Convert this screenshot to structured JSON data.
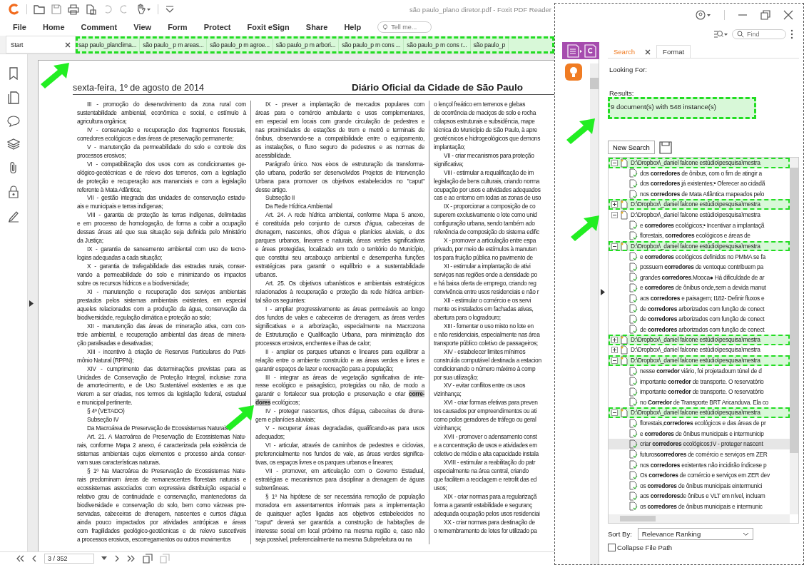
{
  "title_bar": {
    "title": "são paulo_plano diretor.pdf - Foxit PDF Reader"
  },
  "menu": [
    "File",
    "Home",
    "Comment",
    "View",
    "Form",
    "Protect",
    "Foxit eSign",
    "Share",
    "Help"
  ],
  "tell_me": {
    "placeholder": "Tell me..."
  },
  "tab_bar": {
    "highlighted": true,
    "tabs": [
      {
        "label": "Start",
        "selected": true
      },
      {
        "label": "sap paulo_planclima...",
        "selected": false
      },
      {
        "label": "são paulo_ p m areas...",
        "selected": false
      },
      {
        "label": "são paulo_p m agroe...",
        "selected": false
      },
      {
        "label": "são paulo_p m arbori...",
        "selected": false
      },
      {
        "label": "são paulo_p m cons ...",
        "selected": false
      },
      {
        "label": "são paulo_p m cons r...",
        "selected": false
      },
      {
        "label": "são paulo_p",
        "selected": false
      }
    ]
  },
  "document": {
    "header_date": "sexta-feira, 1º de agosto de 2014",
    "header_title": "Diário Oficial da Cidade de São Paulo",
    "columns": [
      {
        "paragraphs": [
          {
            "lines": [
              "III - promoção do desenvolvimento da zona rural com",
              "sustentabilidade ambiental, econômica e social, e estímulo à",
              "agricultura orgânica;"
            ]
          },
          {
            "lines": [
              "IV - conservação e recuperação dos fragmentos florestais,",
              "corredores ecológicos e das áreas de preservação permanente;"
            ]
          },
          {
            "lines": [
              "V - manutenção da permeabilidade do solo e controle dos",
              "processos erosivos;"
            ]
          },
          {
            "lines": [
              "VI - compatibilização dos usos com as condicionantes ge-",
              "ológico-geotécnicas e de relevo dos terrenos, com a legislação",
              "de proteção e recuperação aos mananciais e com a legislação",
              "referente à Mata Atlântica;"
            ]
          },
          {
            "lines": [
              "VII - gestão integrada das unidades de conservação estadu-",
              "ais e municipais e terras indígenas;"
            ]
          },
          {
            "lines": [
              "VIII - garantia de proteção às terras indígenas, delimitadas",
              "e em processo de homologação, de forma a coibir a ocupação",
              "dessas áreas até que sua situação seja definida pelo Ministério",
              "da Justiça;"
            ]
          },
          {
            "lines": [
              "IX - garantia de saneamento ambiental com uso de tecno-",
              "logias adequadas a cada situação;"
            ]
          },
          {
            "lines": [
              "X - garantia de trafegabilidade das estradas rurais, conser-",
              "vando a permeabilidade do solo e minimizando os impactos",
              "sobre os recursos hídricos e a biodiversidade;"
            ]
          },
          {
            "lines": [
              "XI - manutenção e recuperação dos serviços ambientais",
              "prestados pelos sistemas ambientais existentes, em especial",
              "aqueles relacionados com a produção da água, conservação da",
              "biodiversidade, regulação climática e proteção ao solo;"
            ]
          },
          {
            "lines": [
              "XII - manutenção das áreas de mineração ativa, com con-",
              "trole ambiental, e recuperação ambiental das áreas de minera-",
              "ção paralisadas e desativadas;"
            ]
          },
          {
            "lines": [
              "XIII - incentivo à criação de Reservas Particulares do Patri-",
              "mônio Natural (RPPN);"
            ]
          },
          {
            "lines": [
              "XIV - cumprimento das determinações previstas para as",
              "Unidades de Conservação de Proteção Integral, inclusive zona",
              "de amortecimento, e de Uso Sustentável existentes e as que",
              "vierem a ser criadas, nos termos da legislação federal, estadual",
              "e municipal pertinente."
            ]
          },
          {
            "lines": [
              "§ 4º (VETADO)"
            ]
          },
          {
            "lines": [
              "Subseção IV"
            ]
          },
          {
            "lines": [
              "Da Macroárea de Preservação de Ecossistemas Naturais"
            ]
          },
          {
            "lines": [
              "Art. 21. A Macroárea de Preservação de Ecossistemas Natu-",
              "rais, conforme Mapa 2 anexo, é caracterizada pela existência de",
              "sistemas ambientais cujos elementos e processo ainda conser-",
              "vam suas características naturais."
            ]
          },
          {
            "lines": [
              "§ 1º Na Macroárea de Preservação de Ecossistemas Natu-",
              "rais predominam áreas de remanescentes florestais naturais e",
              "ecossistemas associados com expressiva distribuição espacial e",
              "relativo grau de continuidade e conservação, mantenedoras da",
              "biodiversidade e conservação do solo, bem como várzeas pre-",
              "servadas, cabeceiras de drenagem, nascentes e cursos d'água",
              "ainda pouco impactados por atividades antrópicas e áreas",
              "com fragilidades geológico-geotécnicas e de relevo suscetíveis",
              "a processos erosivos, escorregamentos ou outros movimentos"
            ]
          }
        ]
      },
      {
        "paragraphs": [
          {
            "lines": [
              "IX - prever a implantação de mercados populares com",
              "áreas para o comércio ambulante e usos complementares,",
              "em especial em locais com grande circulação de pedestres e",
              "nas proximidades de estações de trem e metrô e terminais de",
              "ônibus, observando-se a compatibilidade entre o equipamento,",
              "as instalações, o fluxo seguro de pedestres e as normas de",
              "acessibilidade."
            ]
          },
          {
            "lines": [
              "Parágrafo único. Nos eixos de estruturação da transforma-",
              "ção urbana, poderão ser desenvolvidos Projetos de Intervenção",
              "Urbana para promover os objetivos estabelecidos no \"caput\"",
              "desse artigo."
            ]
          },
          {
            "lines": [
              "Subseção II"
            ]
          },
          {
            "lines": [
              "Da Rede Hídrica Ambiental"
            ]
          },
          {
            "lines": [
              "Art. 24. A rede hídrica ambiental, conforme Mapa 5 anexo,",
              "é constituída pelo conjunto de cursos d'água, cabeceiras de",
              "drenagem, nascentes, olhos d'água e planícies aluviais, e dos",
              "parques urbanos, lineares e naturais, áreas verdes significativas",
              "e áreas protegidas, localizado em todo o território do Município,",
              "que constitui seu arcabouço ambiental e desempenha funções",
              "estratégicas para garantir o equilíbrio e a sustentabilidade",
              "urbanos."
            ]
          },
          {
            "lines": [
              "Art. 25. Os objetivos urbanísticos e ambientais estratégicos",
              "relacionados à recuperação e proteção da rede hídrica ambien-",
              "tal são os seguintes:"
            ]
          },
          {
            "lines": [
              "I - ampliar progressivamente as áreas permeáveis ao longo",
              "dos fundos de vales e cabeceiras de drenagem, as áreas verdes",
              "significativas e a arborização, especialmente na Macrozona",
              "de Estruturação e Qualificação Urbana, para minimização dos",
              "processos erosivos, enchentes e ilhas de calor;"
            ]
          },
          {
            "lines": [
              "II - ampliar os parques urbanos e lineares para equilibrar a",
              "relação entre o ambiente construído e as áreas verdes e livres e",
              "garantir espaços de lazer e recreação para a população;"
            ]
          },
          {
            "lines": [
              "III - integrar as áreas de vegetação significativa de inte-",
              "resse ecológico e paisagístico, protegidas ou não, de modo a",
              "garantir e fortalecer sua proteção e preservação e criar **corre-**",
              "**dores** ecológicos;"
            ]
          },
          {
            "lines": [
              "IV - proteger nascentes, olhos d'água, cabeceiras de drena-",
              "gem e planícies aluviais;"
            ]
          },
          {
            "lines": [
              "V - recuperar áreas degradadas, qualificando-as para usos",
              "adequados;"
            ]
          },
          {
            "lines": [
              "VI - articular, através de caminhos de pedestres e ciclovias,",
              "preferencialmente nos fundos de vale, as áreas verdes significa-",
              "tivas, os espaços livres e os parques urbanos e lineares;"
            ]
          },
          {
            "lines": [
              "VII - promover, em articulação com o Governo Estadual,",
              "estratégias e mecanismos para disciplinar a drenagem de águas",
              "subterrâneas."
            ]
          },
          {
            "lines": [
              "§ 1º Na hipótese de ser necessária remoção de população",
              "moradora em assentamentos informais para a implementação",
              "de quaisquer ações ligadas aos objetivos estabelecidos no",
              "\"caput\" deverá ser garantida a construção de habitações de",
              "interesse social em local próximo na mesma região e, caso não",
              "seja possível, preferencialmente na mesma Subprefeitura ou na"
            ]
          }
        ]
      },
      {
        "cut": true,
        "paragraphs": [
          {
            "continued": true,
            "lines": [
              "o lençol freático em terrenos e glebas",
              "de ocorrência de maciços de solo e rocha",
              "colapsos estruturais e subsidência, mape",
              "técnica do Município de São Paulo, à apre",
              "geotécnicos e hidrogeológicos que demons",
              "implantação;"
            ]
          },
          {
            "lines": [
              "VII - criar mecanismos para proteção",
              "significativa;"
            ]
          },
          {
            "lines": [
              "VIII - estimular a requalificação de im",
              "legislação de bens culturais, criando norma",
              "ocupação por usos e atividades adequados",
              "cas e ao entorno em todas as zonas de uso"
            ]
          },
          {
            "lines": [
              "IX - proporcionar a composição de co",
              "superem exclusivamente o lote como unid",
              "configuração urbana, sendo também ado",
              "referência de composição do sistema edific"
            ]
          },
          {
            "lines": [
              "X - promover a articulação entre espa",
              "privado, por meio de estímulos à manuten",
              "tos para fruição pública no pavimento de"
            ]
          },
          {
            "lines": [
              "XI - estimular a implantação de ativi",
              "serviços nas regiões onde a densidade po",
              "e há baixa oferta de emprego, criando reg",
              "convivência entre usos residenciais e não r"
            ]
          },
          {
            "lines": [
              "XII - estimular o comércio e os servi",
              "mente os instalados em fachadas ativas,",
              "abertura para o logradouro;"
            ]
          },
          {
            "lines": [
              "XIII - fomentar o uso misto no lote en",
              "e não residenciais, especialmente nas área",
              "transporte público coletivo de passageiros;"
            ]
          },
          {
            "lines": [
              "XIV - estabelecer limites mínimos",
              "construída computável destinada a estacion",
              "condicionando o número máximo à comp",
              "por sua utilização;"
            ]
          },
          {
            "lines": [
              "XV - evitar conflitos entre os usos",
              "vizinhança;"
            ]
          },
          {
            "lines": [
              "XVI - criar formas efetivas para preven",
              "tos causados por empreendimentos ou ati",
              "como polos geradores de tráfego ou geral",
              "vizinhança;"
            ]
          },
          {
            "lines": [
              "XVII - promover o adensamento const",
              "e a concentração de usos e atividades em",
              "coletivo de média e alta capacidade instala"
            ]
          },
          {
            "lines": [
              "XVIII - estimular a reabilitação do patr",
              "especialmente na área central, criando",
              "que facilitem a reciclagem e retrofit das ed",
              "usos;"
            ]
          },
          {
            "lines": [
              "XIX - criar normas para a regularizaçã",
              "forma a garantir estabilidade e seguranç",
              "adequada ocupação pelos usos residenciai"
            ]
          },
          {
            "lines": [
              "XX - criar normas para destinação de",
              "o remembramento de lotes for utilizado pa"
            ]
          }
        ]
      }
    ]
  },
  "page_nav": {
    "page": "3 / 352"
  },
  "find": {
    "placeholder": "Find"
  },
  "search_panel": {
    "tabs": [
      {
        "label": "Search",
        "selected": true
      },
      {
        "label": "Format",
        "selected": false
      }
    ],
    "looking_for_label": "Looking For:",
    "results_label": "Results:",
    "summary": {
      "text": "9 document(s) with 548 instance(s)",
      "highlighted": true
    },
    "new_search": "New Search",
    "results": [
      {
        "path": "D:\\Dropbox\\_daniel falcone estúdio\\pesquisa\\mestra",
        "expanded": true,
        "highlighted": true,
        "children": [
          {
            "text": "dos **corredores** de ônibus, com o fim de atingir a",
            "selected": false
          },
          {
            "text": "dos **corredores** já existentes;• Oferecer ao cidadã",
            "selected": false
          },
          {
            "text": "nos **corredores** de Mata Atlântica mapeados pelo",
            "selected": false
          }
        ]
      },
      {
        "path": "D:\\Dropbox\\_daniel falcone estúdio\\pesquisa\\mestra",
        "expanded": false,
        "highlighted": true
      },
      {
        "path": "D:\\Dropbox\\_daniel falcone estúdio\\pesquisa\\mestra",
        "expanded": true,
        "highlighted": false,
        "children": [
          {
            "text": "e **corredores** ecológicos;• Incentivar a implantaçã",
            "selected": false
          },
          {
            "text": "florestais, **corredores** ecológicos e áreas de",
            "selected": false
          }
        ]
      },
      {
        "path": "D:\\Dropbox\\_daniel falcone estúdio\\pesquisa\\mestra",
        "expanded": true,
        "highlighted": true,
        "children": [
          {
            "text": "e **corredores** ecológicos definidos no PMMA se fa",
            "selected": false
          },
          {
            "text": "possuem **corredores** de ventoque contribuem pa",
            "selected": false
          },
          {
            "text": "grandes **corredores**.Mooca● Há dificuldade de ar",
            "selected": false
          },
          {
            "text": "e **corredores** de ônibus onde,sem a devida manut",
            "selected": false
          },
          {
            "text": "aos **corredores** e paisagem; I182- Definir fluxos e",
            "selected": false
          },
          {
            "text": "de **corredores** arborizados com função de conect",
            "selected": false
          },
          {
            "text": "de **corredores** arborizados com função de conect",
            "selected": false
          },
          {
            "text": "de **corredores** arborizados com função de conect",
            "selected": false
          }
        ]
      },
      {
        "path": "D:\\Dropbox\\_daniel falcone estúdio\\pesquisa\\mestra",
        "expanded": false,
        "highlighted": true
      },
      {
        "path": "D:\\Dropbox\\_daniel falcone estúdio\\pesquisa\\mestra",
        "expanded": false,
        "highlighted": false
      },
      {
        "path": "D:\\Dropbox\\_daniel falcone estúdio\\pesquisa\\mestra",
        "expanded": true,
        "highlighted": true,
        "children": [
          {
            "text": "nesse **corredor** viário, foi projetadoum túnel de d",
            "selected": false
          },
          {
            "text": "importante **corredor** de transporte. O reservatório",
            "selected": false
          },
          {
            "text": "importante **corredor** de transporte. O reservatório",
            "selected": false
          },
          {
            "text": "no **Corredor** de Transporte BRT Aricanduva. Ela co",
            "selected": false
          }
        ]
      },
      {
        "path": "D:\\Dropbox\\_daniel falcone estúdio\\pesquisa\\mestra",
        "expanded": true,
        "highlighted": true,
        "children": [
          {
            "text": "florestais,**corredores** ecológicos e das áreas de pr",
            "selected": false
          },
          {
            "text": "e **corredores** de ônibus municipais e intermunicip",
            "selected": false
          },
          {
            "text": "criar **corredores** ecológicos;IV - proteger nascent",
            "selected": true
          },
          {
            "text": "futuros**corredores** de comércio e serviços em ZER",
            "selected": false
          },
          {
            "text": "nos **corredores** existentes não incidirão índicese p",
            "selected": false
          },
          {
            "text": "Os **corredores** de comércio e serviços em ZER dev",
            "selected": false
          },
          {
            "text": "os **corredores** de ônibus municipais eintermunici",
            "selected": false
          },
          {
            "text": "aos **corredores**de ônibus e VLT em nível, incluam",
            "selected": false
          },
          {
            "text": "os **corredores** de ônibus municipais e intermunic",
            "selected": false
          }
        ]
      }
    ],
    "sort_by": {
      "label": "Sort By:",
      "value": "Relevance Ranking"
    },
    "collapse_path": {
      "label": "Collapse File Path",
      "checked": false
    }
  }
}
